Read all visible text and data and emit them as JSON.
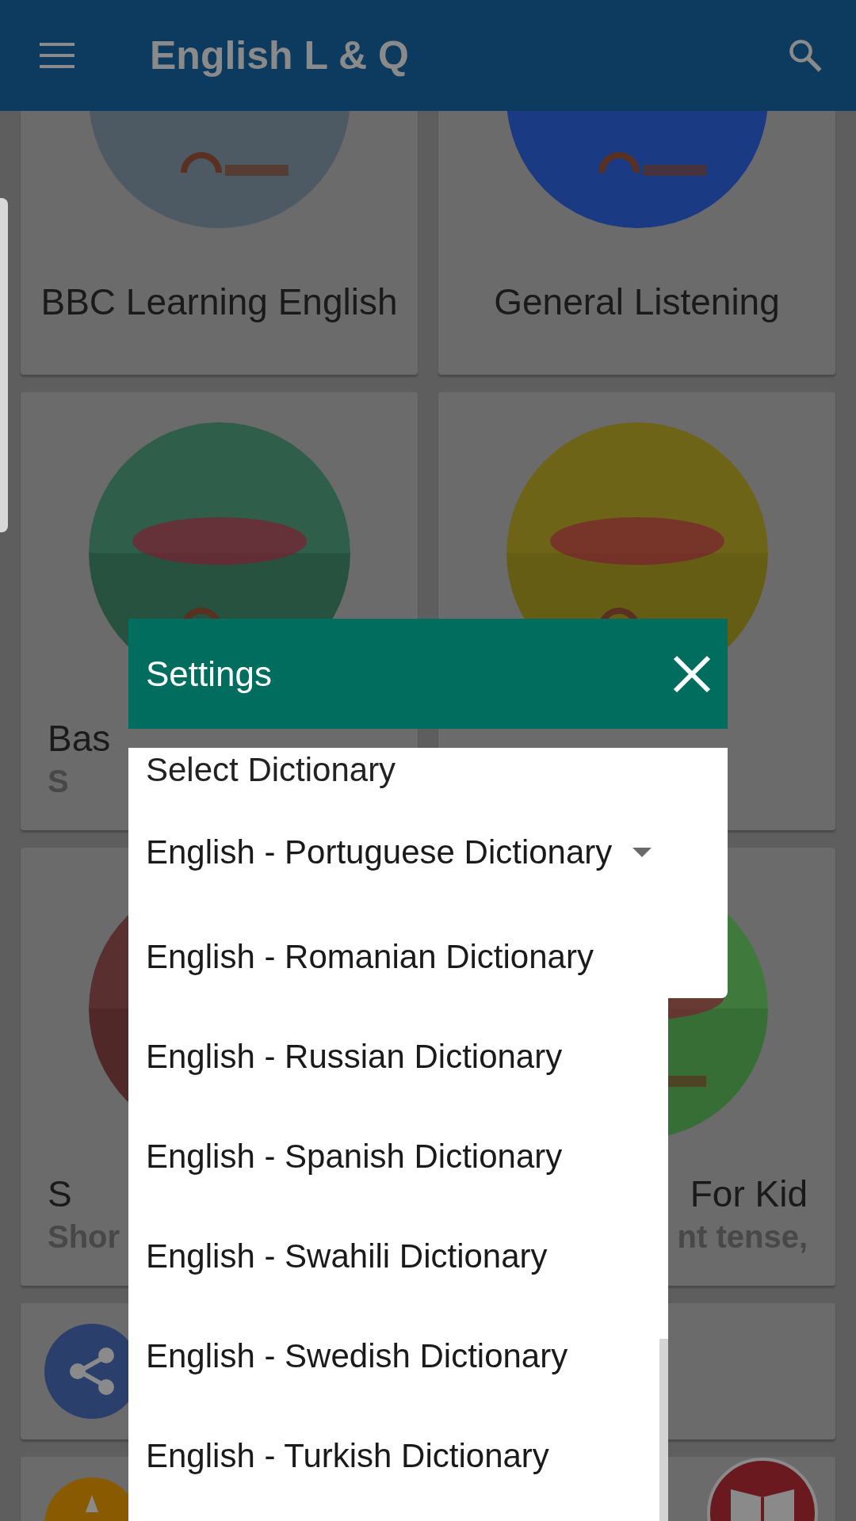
{
  "app_bar": {
    "title": "English L & Q"
  },
  "cards": [
    {
      "kind": "picture",
      "title": "BBC Learning English",
      "cut": false
    },
    {
      "kind": "picture",
      "title": "General Listening",
      "cut": false
    },
    {
      "kind": "picture",
      "title": "Bas",
      "subtitle": "S",
      "cut": true
    },
    {
      "kind": "picture"
    },
    {
      "kind": "picture",
      "title": "S",
      "subtitle": "Shor",
      "cut": true
    },
    {
      "kind": "picture",
      "title": "For Kid",
      "subtitle": "nt tense,",
      "cut": true
    }
  ],
  "dialog": {
    "title": "Settings",
    "field_label": "Select Dictionary",
    "selected_value": "English - Portuguese Dictionary",
    "options": [
      "English - Romanian Dictionary",
      "English - Russian Dictionary",
      "English - Spanish Dictionary",
      "English - Swahili Dictionary",
      "English - Swedish Dictionary",
      "English - Turkish Dictionary"
    ]
  }
}
